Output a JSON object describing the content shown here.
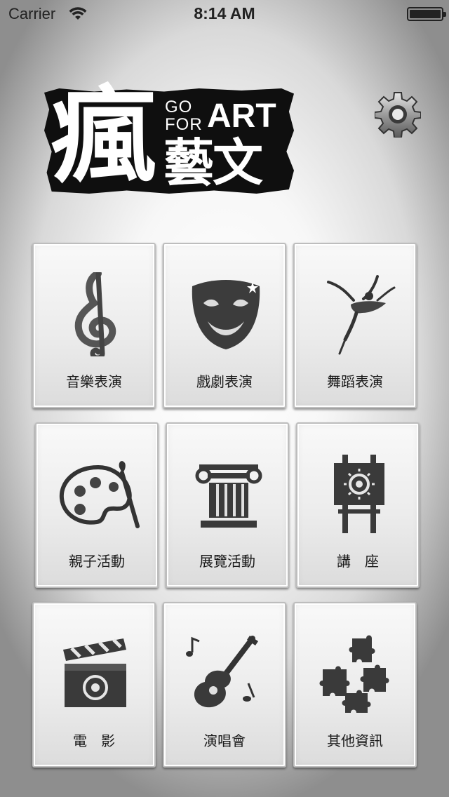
{
  "status_bar": {
    "carrier": "Carrier",
    "time": "8:14 AM"
  },
  "logo": {
    "main_char": "瘋",
    "go": "GO",
    "for": "FOR",
    "art": "ART",
    "sub_chars": "藝文"
  },
  "settings": {
    "icon": "gear-icon"
  },
  "menu": {
    "items": [
      {
        "label": "音樂表演",
        "icon": "treble-clef-icon"
      },
      {
        "label": "戲劇表演",
        "icon": "theater-mask-icon"
      },
      {
        "label": "舞蹈表演",
        "icon": "ballerina-icon"
      },
      {
        "label": "親子活動",
        "icon": "paint-palette-icon"
      },
      {
        "label": "展覽活動",
        "icon": "ionic-column-icon"
      },
      {
        "label": "講　座",
        "icon": "easel-icon"
      },
      {
        "label": "電　影",
        "icon": "clapperboard-icon"
      },
      {
        "label": "演唱會",
        "icon": "guitar-icon"
      },
      {
        "label": "其他資訊",
        "icon": "puzzle-pieces-icon"
      }
    ]
  }
}
